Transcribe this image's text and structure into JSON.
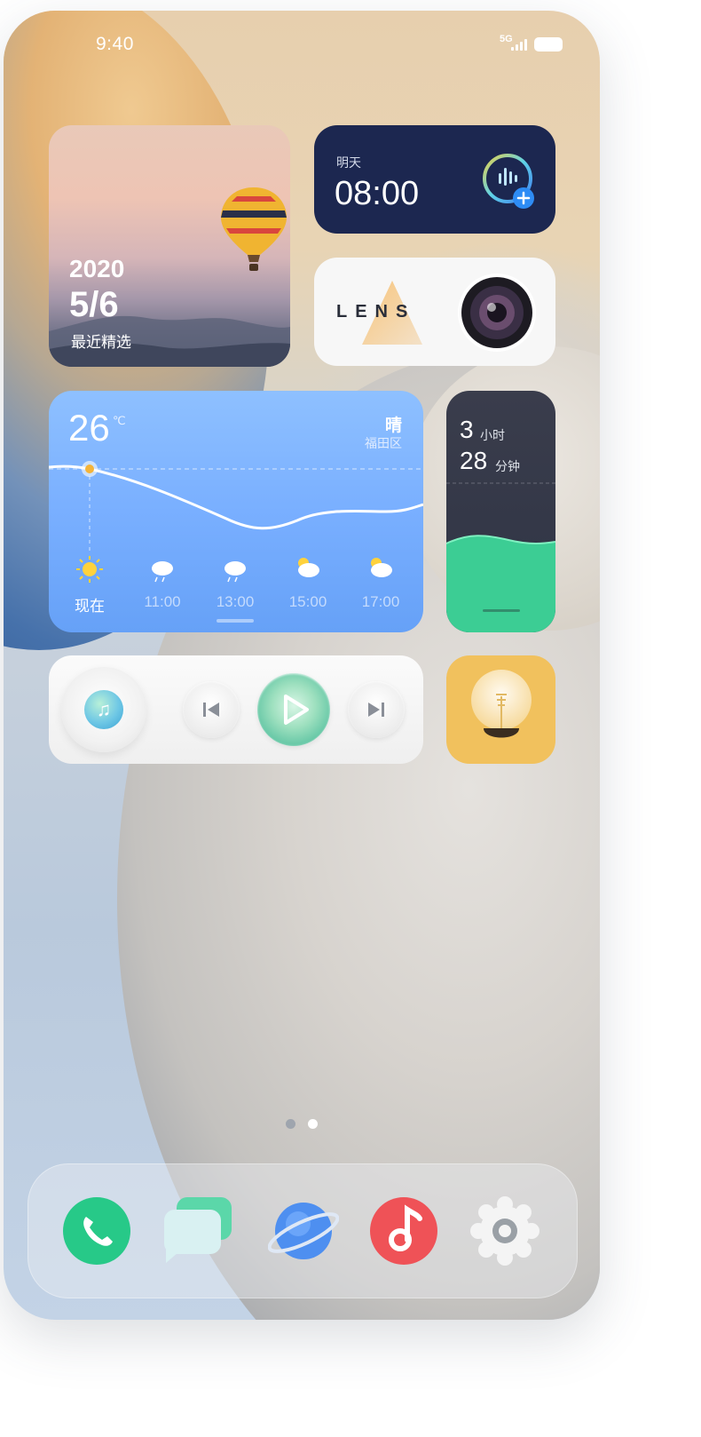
{
  "status_bar": {
    "time": "9:40",
    "network": "5G"
  },
  "widgets": {
    "photo": {
      "year": "2020",
      "date": "5/6",
      "caption": "最近精选"
    },
    "alarm": {
      "day_label": "明天",
      "time": "08:00"
    },
    "lens": {
      "brand": "LENS"
    },
    "weather": {
      "temperature": "26",
      "unit": "℃",
      "condition": "晴",
      "location": "福田区",
      "hours": [
        {
          "label": "现在",
          "icon": "sun-icon"
        },
        {
          "label": "11:00",
          "icon": "rain-cloud-icon"
        },
        {
          "label": "13:00",
          "icon": "rain-cloud-icon"
        },
        {
          "label": "15:00",
          "icon": "partly-cloudy-icon"
        },
        {
          "label": "17:00",
          "icon": "partly-cloudy-icon"
        }
      ]
    },
    "screen_time": {
      "hours": "3",
      "hours_unit": "小时",
      "minutes": "28",
      "minutes_unit": "分钟"
    },
    "music": {
      "controls": [
        "previous-icon",
        "play-icon",
        "next-icon"
      ]
    },
    "flashlight": {
      "icon": "lightbulb-icon"
    }
  },
  "page_indicator": {
    "count": 2,
    "active": 2
  },
  "dock": {
    "apps": [
      "phone-icon",
      "messages-icon",
      "browser-icon",
      "music-icon",
      "settings-icon"
    ]
  },
  "colors": {
    "alarm_bg": "#1c2750",
    "weather_bg": "#79afff",
    "screen_time_bg": "#343848",
    "screen_time_wave": "#3fcf98",
    "flashlight_bg": "#f1c15d",
    "phone_app": "#27c988",
    "music_app": "#ef5257"
  }
}
